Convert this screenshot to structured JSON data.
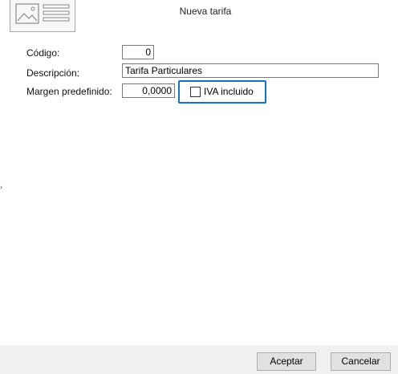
{
  "dialog": {
    "title": "Nueva tarifa"
  },
  "form": {
    "codigo_label": "Código:",
    "codigo_value": "0",
    "descripcion_label": "Descripción:",
    "descripcion_value": "Tarifa Particulares",
    "margen_label": "Margen predefinido:",
    "margen_value": "0,0000",
    "iva_label": "IVA incluido",
    "iva_checked": false
  },
  "footer": {
    "accept_label": "Aceptar",
    "cancel_label": "Cancelar"
  },
  "icons": {
    "thumbnail": "image-placeholder-icon",
    "side": "chevron-right-icon"
  },
  "colors": {
    "focus_border": "#1474c4",
    "footer_bg": "#f0f0f0"
  }
}
